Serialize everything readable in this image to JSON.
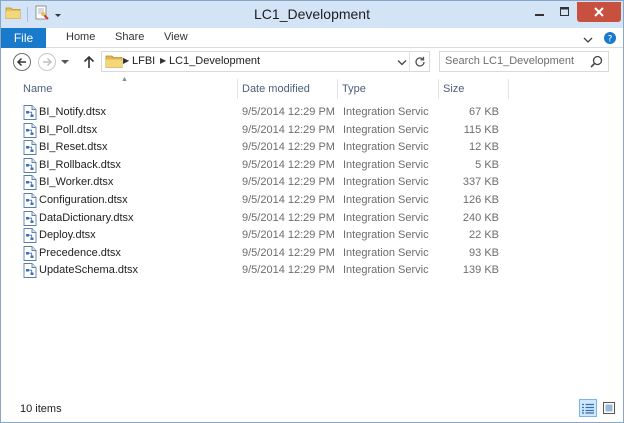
{
  "window": {
    "title": "LC1_Development"
  },
  "ribbon": {
    "file_label": "File",
    "home_label": "Home",
    "share_label": "Share",
    "view_label": "View"
  },
  "address": {
    "crumbs": [
      "LFBI",
      "LC1_Development"
    ]
  },
  "search": {
    "placeholder": "Search LC1_Development"
  },
  "columns": {
    "name": "Name",
    "date": "Date modified",
    "type": "Type",
    "size": "Size"
  },
  "files": [
    {
      "name": "BI_Notify.dtsx",
      "date": "9/5/2014 12:29 PM",
      "type": "Integration Servic...",
      "size": "67 KB"
    },
    {
      "name": "BI_Poll.dtsx",
      "date": "9/5/2014 12:29 PM",
      "type": "Integration Servic...",
      "size": "115 KB"
    },
    {
      "name": "BI_Reset.dtsx",
      "date": "9/5/2014 12:29 PM",
      "type": "Integration Servic...",
      "size": "12 KB"
    },
    {
      "name": "BI_Rollback.dtsx",
      "date": "9/5/2014 12:29 PM",
      "type": "Integration Servic...",
      "size": "5 KB"
    },
    {
      "name": "BI_Worker.dtsx",
      "date": "9/5/2014 12:29 PM",
      "type": "Integration Servic...",
      "size": "337 KB"
    },
    {
      "name": "Configuration.dtsx",
      "date": "9/5/2014 12:29 PM",
      "type": "Integration Servic...",
      "size": "126 KB"
    },
    {
      "name": "DataDictionary.dtsx",
      "date": "9/5/2014 12:29 PM",
      "type": "Integration Servic...",
      "size": "240 KB"
    },
    {
      "name": "Deploy.dtsx",
      "date": "9/5/2014 12:29 PM",
      "type": "Integration Servic...",
      "size": "22 KB"
    },
    {
      "name": "Precedence.dtsx",
      "date": "9/5/2014 12:29 PM",
      "type": "Integration Servic...",
      "size": "93 KB"
    },
    {
      "name": "UpdateSchema.dtsx",
      "date": "9/5/2014 12:29 PM",
      "type": "Integration Servic...",
      "size": "139 KB"
    }
  ],
  "status": {
    "item_count": "10 items"
  },
  "colors": {
    "title_bar": "#d4e4f7",
    "file_tab": "#1979ca",
    "close_button": "#c7503f",
    "folder": "#e8c156"
  }
}
